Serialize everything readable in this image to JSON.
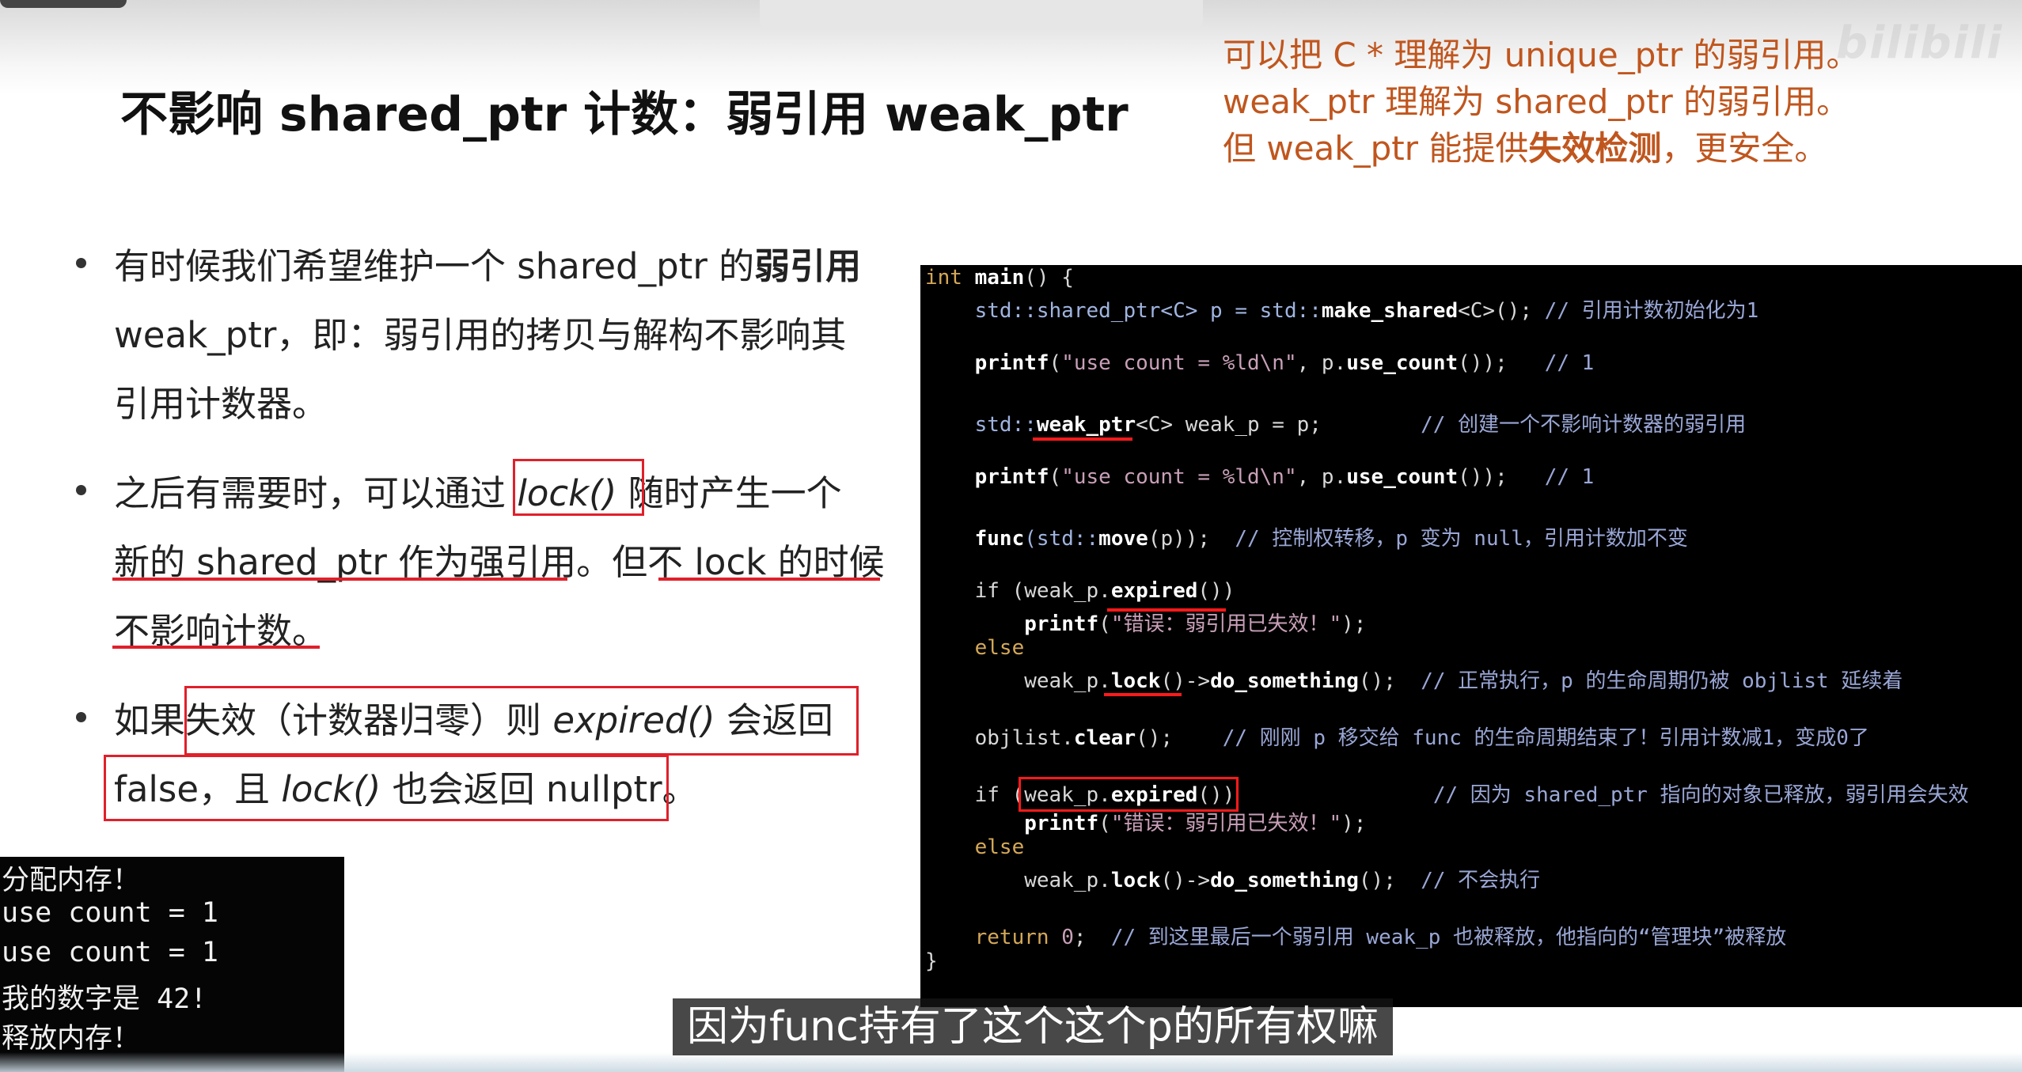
{
  "watermark": "bilibili",
  "slide": {
    "title": "不影响 shared_ptr 计数：弱引用 weak_ptr",
    "note": {
      "line1": "可以把 C * 理解为 unique_ptr 的弱引用。",
      "line2": "weak_ptr 理解为 shared_ptr 的弱引用。",
      "line3_pre": "但 weak_ptr 能提供",
      "line3_bold": "失效检测",
      "line3_post": "，更安全。"
    },
    "bullets": {
      "b1_l1_pre": "有时候我们希望维护一个 shared_ptr 的",
      "b1_l1_bold": "弱引用",
      "b1_l2": "weak_ptr，即：弱引用的拷贝与解构不影响其",
      "b1_l3": "引用计数器。",
      "b2_l1_pre": "之后有需要时，可以通过 ",
      "b2_l1_ital": "lock()",
      "b2_l1_post": " 随时产生一个",
      "b2_l2": "新的 shared_ptr 作为强引用。但不 lock 的时候",
      "b2_l3": "不影响计数。",
      "b3_l1_pre": "如果失效（计数器归零）则 ",
      "b3_l1_ital": "expired()",
      "b3_l1_post": " 会返回",
      "b3_l2_pre": "false，且 ",
      "b3_l2_ital": "lock()",
      "b3_l2_post": " 也会返回 nullptr。"
    }
  },
  "terminal": {
    "lines": [
      "分配内存！",
      "use count = 1",
      "use count = 1",
      "我的数字是 42!",
      "释放内存！"
    ]
  },
  "code": {
    "l1_a": "int",
    "l1_b": " main",
    "l1_c": "() {",
    "l2_a": "    std::shared_ptr<C> p = std::",
    "l2_b": "make_shared",
    "l2_c": "<C>(); ",
    "l2_d": "// 引用计数初始化为1",
    "l3_a": "    ",
    "l3_b": "printf",
    "l3_c": "(",
    "l3_d": "\"use count = %ld\\n\"",
    "l3_e": ", p.",
    "l3_f": "use_count",
    "l3_g": "());   ",
    "l3_h": "// 1",
    "l4_a": "    std::",
    "l4_b": "weak_ptr",
    "l4_c": "<C> weak_p = p;        ",
    "l4_d": "// 创建一个不影响计数器的弱引用",
    "l5_a": "    ",
    "l5_b": "printf",
    "l5_c": "(",
    "l5_d": "\"use count = %ld\\n\"",
    "l5_e": ", p.",
    "l5_f": "use_count",
    "l5_g": "());   ",
    "l5_h": "// 1",
    "l6_a": "    ",
    "l6_b": "func",
    "l6_c": "(std::",
    "l6_d": "move",
    "l6_e": "(p));  ",
    "l6_f": "// 控制权转移，p 变为 null，引用计数加不变",
    "l7_a": "    if (weak_p.",
    "l7_b": "expired",
    "l7_c": "())",
    "l8_a": "        ",
    "l8_b": "printf",
    "l8_c": "(",
    "l8_d": "\"错误：弱引用已失效！\"",
    "l8_e": ");",
    "l9": "    else",
    "l10_a": "        weak_p.",
    "l10_b": "lock",
    "l10_c": "()->",
    "l10_d": "do_something",
    "l10_e": "();  ",
    "l10_f": "// 正常执行，p 的生命周期仍被 objlist 延续着",
    "l11_a": "    objlist.",
    "l11_b": "clear",
    "l11_c": "();    ",
    "l11_d": "// 刚刚 p 移交给 func 的生命周期结束了！引用计数减1，变成0了",
    "l12_a": "    if (weak_p.",
    "l12_b": "expired",
    "l12_c": "())                ",
    "l12_d": "// 因为 shared_ptr 指向的对象已释放，弱引用会失效",
    "l13_a": "        ",
    "l13_b": "printf",
    "l13_c": "(",
    "l13_d": "\"错误：弱引用已失效！\"",
    "l13_e": ");",
    "l14": "    else",
    "l15_a": "        weak_p.",
    "l15_b": "lock",
    "l15_c": "()->",
    "l15_d": "do_something",
    "l15_e": "();  ",
    "l15_f": "// 不会执行",
    "l16_a": "    return ",
    "l16_b": "0",
    "l16_c": ";  ",
    "l16_d": "// 到这里最后一个弱引用 weak_p 也被释放，他指向的“管理块”被释放",
    "l17": "}"
  },
  "subtitle": "因为func持有了这个这个p的所有权嘛",
  "colors": {
    "accent_note": "#c0561e",
    "highlight_red": "#e0202a"
  }
}
